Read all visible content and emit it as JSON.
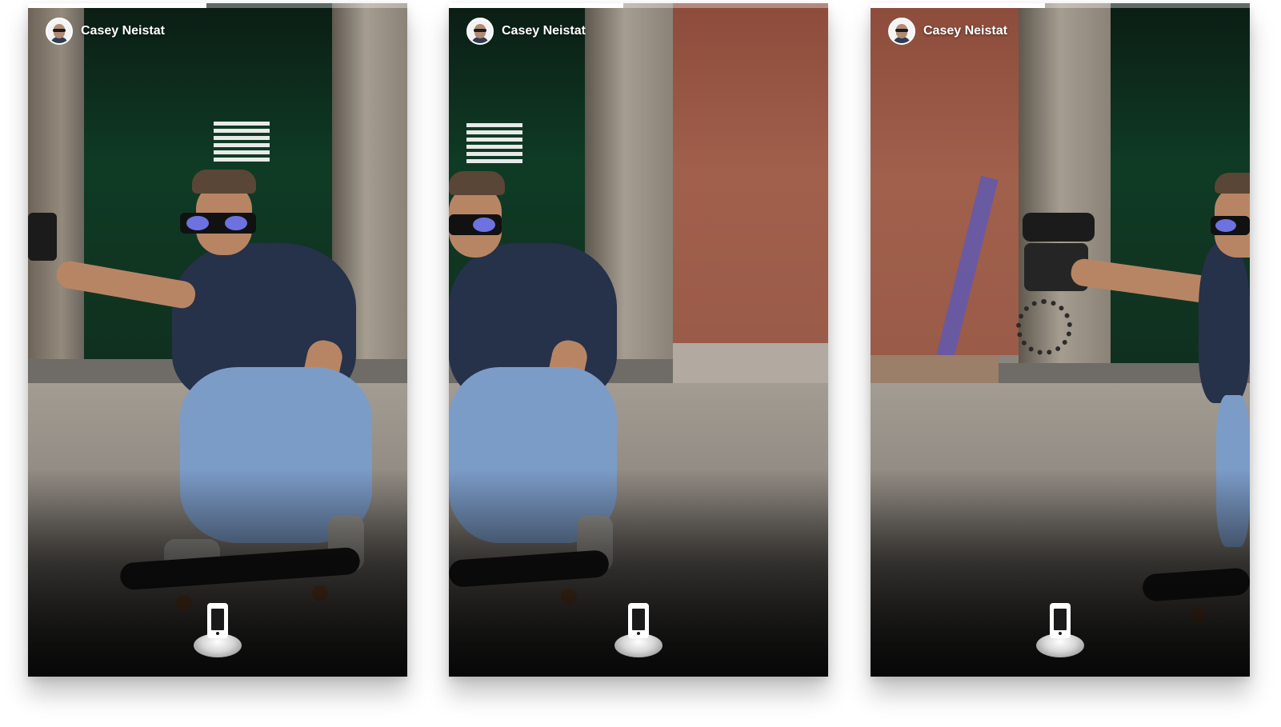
{
  "colors": {
    "progress_track": "#ffffff59",
    "progress_fill": "#ffffff",
    "door_green": "#0f3b25",
    "brick": "#9a5b48",
    "stone": "#8b8278",
    "road": "#a39c93"
  },
  "panels": [
    {
      "username": "Casey Neistat",
      "progress": 0.47,
      "footer_icon": "phone-icon"
    },
    {
      "username": "Casey Neistat",
      "progress": 0.46,
      "footer_icon": "phone-icon"
    },
    {
      "username": "Casey Neistat",
      "progress": 0.46,
      "footer_icon": "phone-icon"
    }
  ]
}
